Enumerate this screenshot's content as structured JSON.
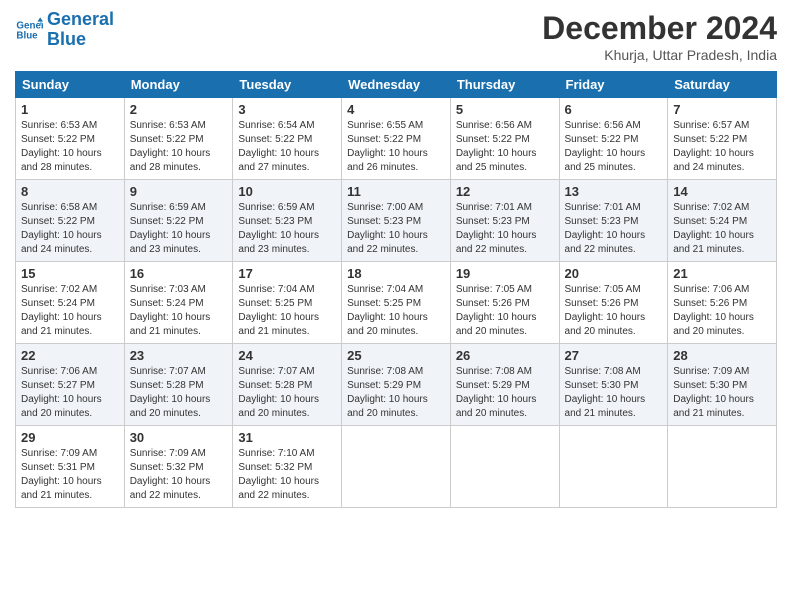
{
  "logo": {
    "line1": "General",
    "line2": "Blue"
  },
  "title": "December 2024",
  "subtitle": "Khurja, Uttar Pradesh, India",
  "days_of_week": [
    "Sunday",
    "Monday",
    "Tuesday",
    "Wednesday",
    "Thursday",
    "Friday",
    "Saturday"
  ],
  "weeks": [
    [
      {
        "day": 1,
        "info": "Sunrise: 6:53 AM\nSunset: 5:22 PM\nDaylight: 10 hours\nand 28 minutes."
      },
      {
        "day": 2,
        "info": "Sunrise: 6:53 AM\nSunset: 5:22 PM\nDaylight: 10 hours\nand 28 minutes."
      },
      {
        "day": 3,
        "info": "Sunrise: 6:54 AM\nSunset: 5:22 PM\nDaylight: 10 hours\nand 27 minutes."
      },
      {
        "day": 4,
        "info": "Sunrise: 6:55 AM\nSunset: 5:22 PM\nDaylight: 10 hours\nand 26 minutes."
      },
      {
        "day": 5,
        "info": "Sunrise: 6:56 AM\nSunset: 5:22 PM\nDaylight: 10 hours\nand 25 minutes."
      },
      {
        "day": 6,
        "info": "Sunrise: 6:56 AM\nSunset: 5:22 PM\nDaylight: 10 hours\nand 25 minutes."
      },
      {
        "day": 7,
        "info": "Sunrise: 6:57 AM\nSunset: 5:22 PM\nDaylight: 10 hours\nand 24 minutes."
      }
    ],
    [
      {
        "day": 8,
        "info": "Sunrise: 6:58 AM\nSunset: 5:22 PM\nDaylight: 10 hours\nand 24 minutes."
      },
      {
        "day": 9,
        "info": "Sunrise: 6:59 AM\nSunset: 5:22 PM\nDaylight: 10 hours\nand 23 minutes."
      },
      {
        "day": 10,
        "info": "Sunrise: 6:59 AM\nSunset: 5:23 PM\nDaylight: 10 hours\nand 23 minutes."
      },
      {
        "day": 11,
        "info": "Sunrise: 7:00 AM\nSunset: 5:23 PM\nDaylight: 10 hours\nand 22 minutes."
      },
      {
        "day": 12,
        "info": "Sunrise: 7:01 AM\nSunset: 5:23 PM\nDaylight: 10 hours\nand 22 minutes."
      },
      {
        "day": 13,
        "info": "Sunrise: 7:01 AM\nSunset: 5:23 PM\nDaylight: 10 hours\nand 22 minutes."
      },
      {
        "day": 14,
        "info": "Sunrise: 7:02 AM\nSunset: 5:24 PM\nDaylight: 10 hours\nand 21 minutes."
      }
    ],
    [
      {
        "day": 15,
        "info": "Sunrise: 7:02 AM\nSunset: 5:24 PM\nDaylight: 10 hours\nand 21 minutes."
      },
      {
        "day": 16,
        "info": "Sunrise: 7:03 AM\nSunset: 5:24 PM\nDaylight: 10 hours\nand 21 minutes."
      },
      {
        "day": 17,
        "info": "Sunrise: 7:04 AM\nSunset: 5:25 PM\nDaylight: 10 hours\nand 21 minutes."
      },
      {
        "day": 18,
        "info": "Sunrise: 7:04 AM\nSunset: 5:25 PM\nDaylight: 10 hours\nand 20 minutes."
      },
      {
        "day": 19,
        "info": "Sunrise: 7:05 AM\nSunset: 5:26 PM\nDaylight: 10 hours\nand 20 minutes."
      },
      {
        "day": 20,
        "info": "Sunrise: 7:05 AM\nSunset: 5:26 PM\nDaylight: 10 hours\nand 20 minutes."
      },
      {
        "day": 21,
        "info": "Sunrise: 7:06 AM\nSunset: 5:26 PM\nDaylight: 10 hours\nand 20 minutes."
      }
    ],
    [
      {
        "day": 22,
        "info": "Sunrise: 7:06 AM\nSunset: 5:27 PM\nDaylight: 10 hours\nand 20 minutes."
      },
      {
        "day": 23,
        "info": "Sunrise: 7:07 AM\nSunset: 5:28 PM\nDaylight: 10 hours\nand 20 minutes."
      },
      {
        "day": 24,
        "info": "Sunrise: 7:07 AM\nSunset: 5:28 PM\nDaylight: 10 hours\nand 20 minutes."
      },
      {
        "day": 25,
        "info": "Sunrise: 7:08 AM\nSunset: 5:29 PM\nDaylight: 10 hours\nand 20 minutes."
      },
      {
        "day": 26,
        "info": "Sunrise: 7:08 AM\nSunset: 5:29 PM\nDaylight: 10 hours\nand 20 minutes."
      },
      {
        "day": 27,
        "info": "Sunrise: 7:08 AM\nSunset: 5:30 PM\nDaylight: 10 hours\nand 21 minutes."
      },
      {
        "day": 28,
        "info": "Sunrise: 7:09 AM\nSunset: 5:30 PM\nDaylight: 10 hours\nand 21 minutes."
      }
    ],
    [
      {
        "day": 29,
        "info": "Sunrise: 7:09 AM\nSunset: 5:31 PM\nDaylight: 10 hours\nand 21 minutes."
      },
      {
        "day": 30,
        "info": "Sunrise: 7:09 AM\nSunset: 5:32 PM\nDaylight: 10 hours\nand 22 minutes."
      },
      {
        "day": 31,
        "info": "Sunrise: 7:10 AM\nSunset: 5:32 PM\nDaylight: 10 hours\nand 22 minutes."
      },
      null,
      null,
      null,
      null
    ]
  ]
}
